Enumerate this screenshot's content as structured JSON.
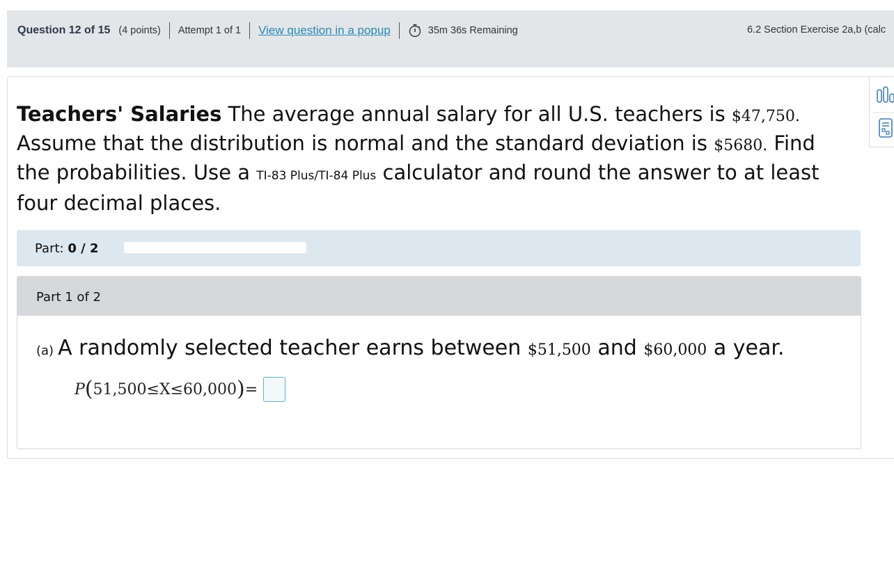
{
  "header": {
    "question_label": "Question 12 of 15",
    "points": "(4 points)",
    "attempt": "Attempt 1 of 1",
    "popup_link": "View question in a popup",
    "timer_text": "35m 36s Remaining",
    "exercise_label": "6.2 Section Exercise 2a,b (calc"
  },
  "intro": {
    "title": "Teachers' Salaries",
    "t1": " The average annual salary for all U.S. teachers is ",
    "mean": "$47,750.",
    "t2": " Assume that the distribution is normal and the standard deviation is ",
    "sd": "$5680.",
    "t3": " Find the probabilities. Use a ",
    "calculator": "TI-83 Plus/TI-84 Plus",
    "t4": " calculator and round the answer to at least four decimal places."
  },
  "part_progress": {
    "label": "Part:",
    "value": "0 / 2",
    "fraction_complete": 0
  },
  "section": {
    "heading": "Part 1 of 2",
    "letter": "(a)",
    "q1": "A randomly selected teacher earns between ",
    "low": "$51,500",
    "q2": " and ",
    "high": "$60,000",
    "q3": " a year.",
    "formula_p": "P",
    "formula_body": "51,500≤X≤60,000",
    "formula_eq": "="
  },
  "icons": {
    "timer": "stopwatch-icon",
    "tool1": "statistics-chart-icon",
    "tool2": "calculator-icon"
  },
  "colors": {
    "header_bg": "#e2e6e9",
    "link": "#2a88b5",
    "part_bar_bg": "#dde7ef",
    "section_head_bg": "#d5d8db",
    "answer_border": "#5ab0d4"
  }
}
